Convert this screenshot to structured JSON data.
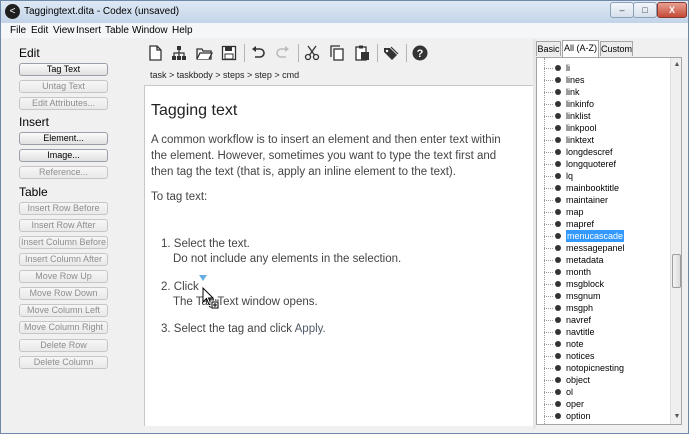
{
  "window": {
    "title": "Taggingtext.dita - Codex (unsaved)",
    "app_icon": "<",
    "minimize": "–",
    "maximize": "□",
    "close": "X"
  },
  "menu": [
    "File",
    "Edit",
    "View",
    "Insert",
    "Table",
    "Window",
    "Help"
  ],
  "toolbar_icons": [
    "new-document-icon",
    "structure-icon",
    "open-folder-icon",
    "save-icon",
    "undo-icon",
    "redo-icon",
    "cut-icon",
    "copy-icon",
    "paste-icon",
    "tag-icon",
    "help-icon"
  ],
  "breadcrumb": "task > taskbody > steps > step > cmd",
  "left_panel": {
    "edit_heading": "Edit",
    "edit_buttons": [
      {
        "label": "Tag Text",
        "enabled": true
      },
      {
        "label": "Untag Text",
        "enabled": false
      },
      {
        "label": "Edit Attributes...",
        "enabled": false
      }
    ],
    "insert_heading": "Insert",
    "insert_buttons": [
      {
        "label": "Element...",
        "enabled": true
      },
      {
        "label": "Image...",
        "enabled": true
      },
      {
        "label": "Reference...",
        "enabled": false
      }
    ],
    "table_heading": "Table",
    "table_buttons": [
      {
        "label": "Insert Row Before",
        "enabled": false
      },
      {
        "label": "Insert Row After",
        "enabled": false
      },
      {
        "label": "Insert Column Before",
        "enabled": false
      },
      {
        "label": "Insert Column After",
        "enabled": false
      },
      {
        "label": "Move Row Up",
        "enabled": false
      },
      {
        "label": "Move Row Down",
        "enabled": false
      },
      {
        "label": "Move Column Left",
        "enabled": false
      },
      {
        "label": "Move Column Right",
        "enabled": false
      },
      {
        "label": "Delete Row",
        "enabled": false
      },
      {
        "label": "Delete Column",
        "enabled": false
      }
    ]
  },
  "document": {
    "title": "Tagging text",
    "paragraph": "A common workflow is to insert an element and then enter text within the element. However, sometimes you want to type the text first and then tag the text (that is, apply an inline element to the text).",
    "intro": "To tag text:",
    "step1": "1. Select the text.",
    "step1_sub": "Do not include any elements in the selection.",
    "step2": "2. Click",
    "step2_sub": "The Tag Text window opens.",
    "step3": "3. Select the tag and click",
    "step3_apply": "Apply."
  },
  "right_panel": {
    "tabs": [
      {
        "label": "Basic",
        "active": false
      },
      {
        "label": "All (A-Z)",
        "active": true
      },
      {
        "label": "Custom",
        "active": false
      }
    ],
    "elements": [
      "li",
      "lines",
      "link",
      "linkinfo",
      "linklist",
      "linkpool",
      "linktext",
      "longdescref",
      "longquoteref",
      "lq",
      "mainbooktitle",
      "maintainer",
      "map",
      "mapref",
      "menucascade",
      "messagepanel",
      "metadata",
      "month",
      "msgblock",
      "msgnum",
      "msgph",
      "navref",
      "navtitle",
      "note",
      "notices",
      "notopicnesting",
      "object",
      "ol",
      "oper",
      "option"
    ],
    "selected": "menucascade"
  },
  "colors": {
    "selection": "#3399ff",
    "cursor_marker": "#67aee0"
  }
}
